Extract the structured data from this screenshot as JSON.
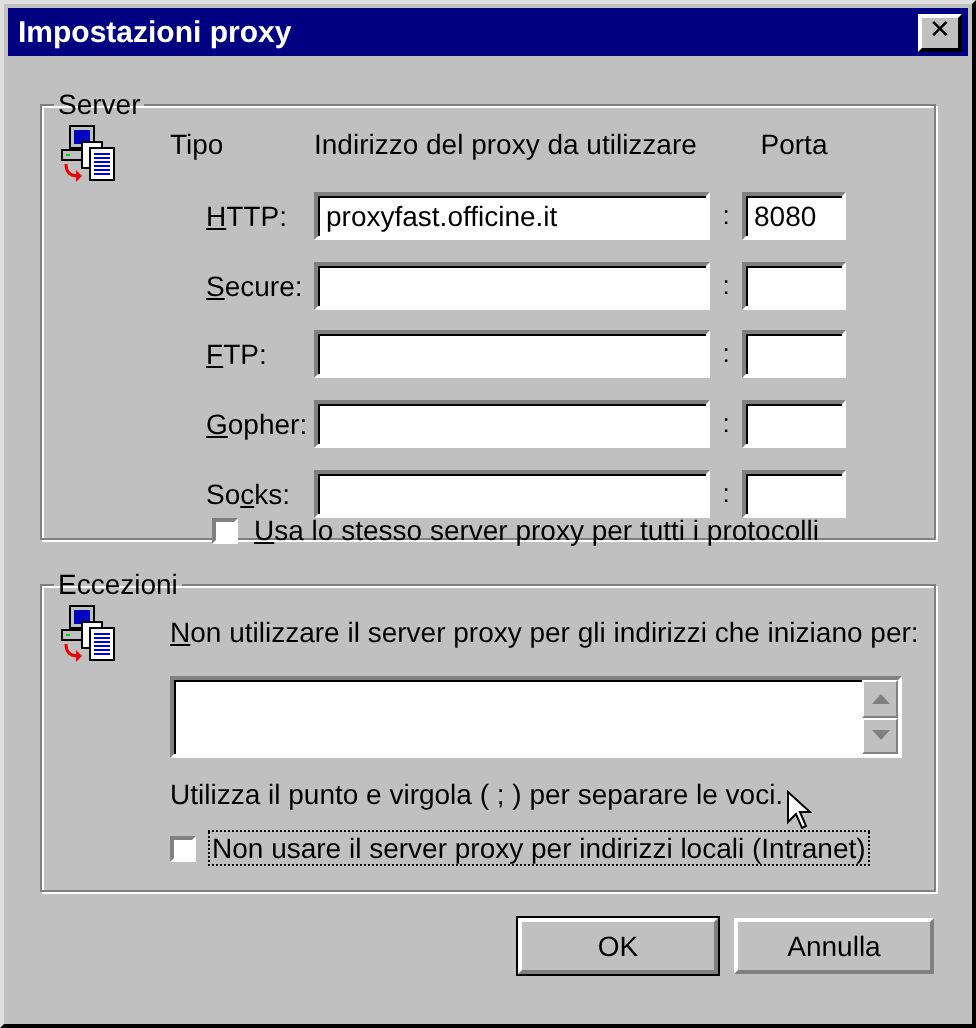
{
  "window": {
    "title": "Impostazioni proxy",
    "close": "✕"
  },
  "server": {
    "legend": "Server",
    "col_type": "Tipo",
    "col_address": "Indirizzo del proxy da utilizzare",
    "col_port": "Porta",
    "separator": ":",
    "rows": [
      {
        "key": "H",
        "after": "TTP:",
        "address": "proxyfast.officine.it",
        "port": "8080"
      },
      {
        "key": "S",
        "after": "ecure:"
      },
      {
        "key": "F",
        "after": "TP:"
      },
      {
        "key": "G",
        "after": "opher:"
      },
      {
        "before": "So",
        "key": "c",
        "after": "ks:"
      }
    ],
    "same_proxy": {
      "key": "U",
      "after": "sa lo stesso server proxy per tutti i protocolli",
      "checked": false,
      "focused": false
    }
  },
  "exceptions": {
    "legend": "Eccezioni",
    "prompt": {
      "key": "N",
      "after": "on utilizzare il server proxy per gli indirizzi che iniziano per:"
    },
    "hint": "Utilizza il punto e virgola ( ; ) per separare le voci.",
    "local": {
      "before": "Non usare il server proxy per indirizzi locali (Intranet)",
      "checked": false,
      "focused": true
    }
  },
  "buttons": [
    {
      "label": "OK",
      "default": true
    },
    {
      "label": "Annulla",
      "default": false
    }
  ]
}
